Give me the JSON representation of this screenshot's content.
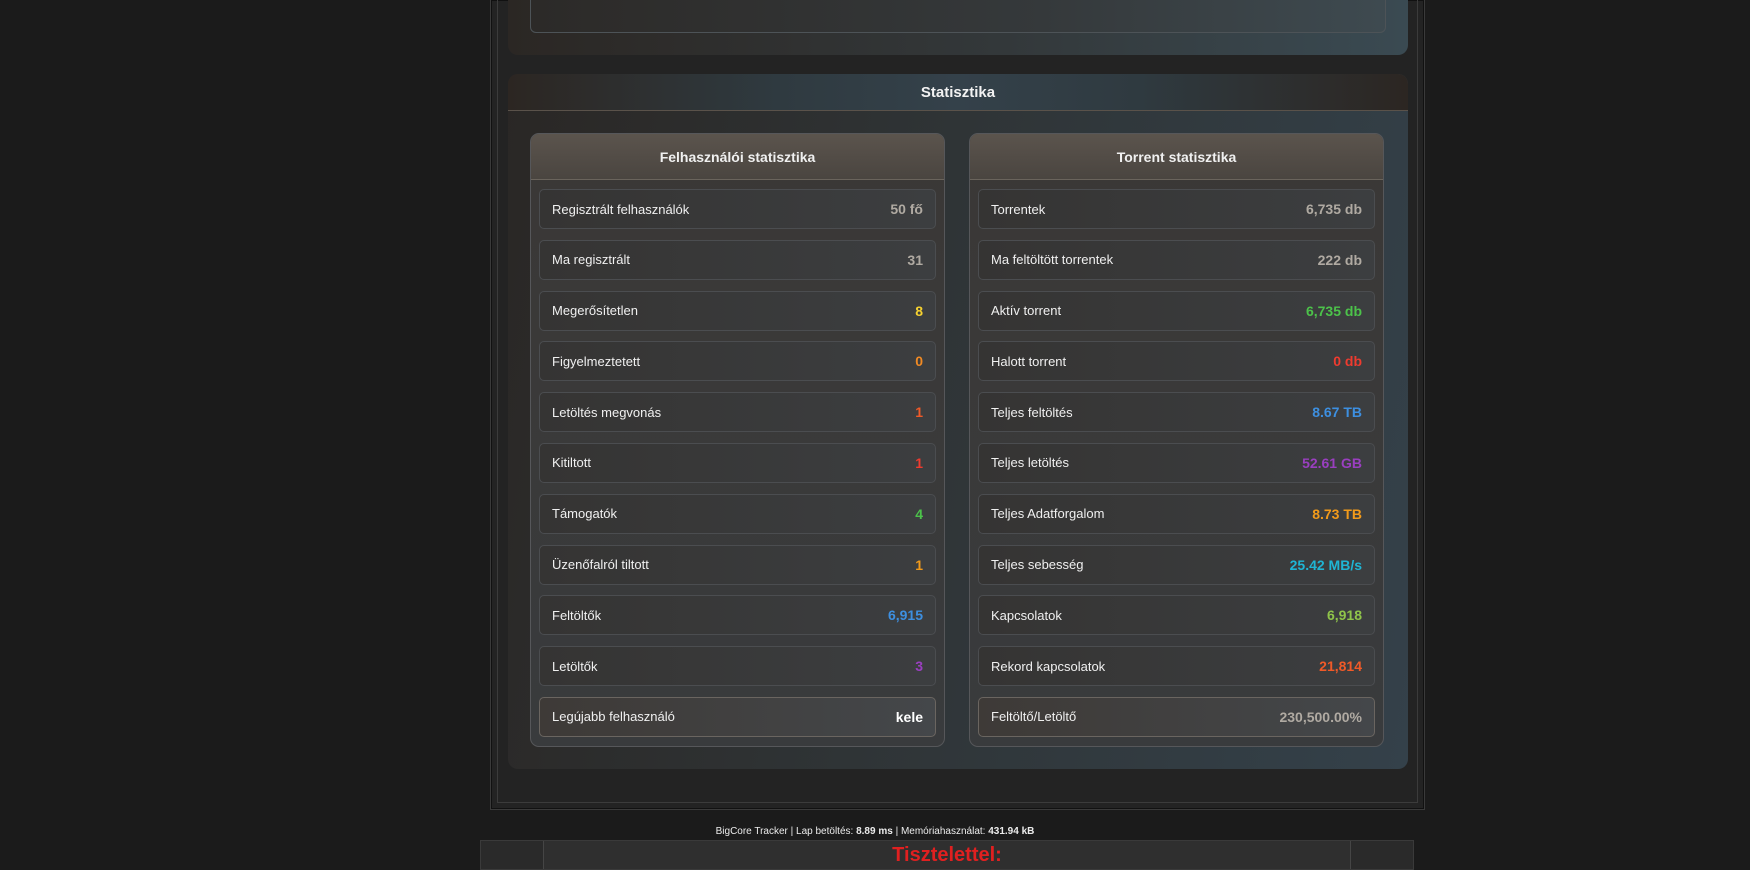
{
  "stats": {
    "title": "Statisztika",
    "user_stats": {
      "title": "Felhasználói statisztika",
      "rows": [
        {
          "label": "Regisztrált felhasználók",
          "value": "50 fő",
          "color": "#b0aaa2"
        },
        {
          "label": "Ma regisztrált",
          "value": "31",
          "color": "#b0aaa2"
        },
        {
          "label": "Megerősítetlen",
          "value": "8",
          "color": "#f5d130"
        },
        {
          "label": "Figyelmeztetett",
          "value": "0",
          "color": "#f08a24"
        },
        {
          "label": "Letöltés megvonás",
          "value": "1",
          "color": "#f05a28"
        },
        {
          "label": "Kitiltott",
          "value": "1",
          "color": "#ee3b2f"
        },
        {
          "label": "Támogatók",
          "value": "4",
          "color": "#4cc24a"
        },
        {
          "label": "Üzenőfalról tiltott",
          "value": "1",
          "color": "#f29a1a"
        },
        {
          "label": "Feltöltők",
          "value": "6,915",
          "color": "#3d8fe0"
        },
        {
          "label": "Letöltők",
          "value": "3",
          "color": "#9a3fc0"
        },
        {
          "label": "Legújabb felhasználó",
          "value": "kele",
          "color": "#ffffff",
          "highlight": true
        }
      ]
    },
    "torrent_stats": {
      "title": "Torrent statisztika",
      "rows": [
        {
          "label": "Torrentek",
          "value": "6,735 db",
          "color": "#b0aaa2"
        },
        {
          "label": "Ma feltöltött torrentek",
          "value": "222 db",
          "color": "#b0aaa2"
        },
        {
          "label": "Aktív torrent",
          "value": "6,735 db",
          "color": "#4cc24a"
        },
        {
          "label": "Halott torrent",
          "value": "0 db",
          "color": "#ee3b2f"
        },
        {
          "label": "Teljes feltöltés",
          "value": "8.67 TB",
          "color": "#3d8fe0"
        },
        {
          "label": "Teljes letöltés",
          "value": "52.61 GB",
          "color": "#9a3fc0"
        },
        {
          "label": "Teljes Adatforgalom",
          "value": "8.73 TB",
          "color": "#f29a1a"
        },
        {
          "label": "Teljes sebesség",
          "value": "25.42 MB/s",
          "color": "#1fb5d4"
        },
        {
          "label": "Kapcsolatok",
          "value": "6,918",
          "color": "#8fc44a"
        },
        {
          "label": "Rekord kapcsolatok",
          "value": "21,814",
          "color": "#f05a28"
        },
        {
          "label": "Feltöltő/Letöltő",
          "value": "230,500.00%",
          "color": "#b0aaa2",
          "highlight": true
        }
      ]
    }
  },
  "footer": {
    "site": "BigCore Tracker",
    "load_label": "Lap betöltés:",
    "load_value": "8.89 ms",
    "memory_label": "Memóriahasználat:",
    "memory_value": "431.94 kB",
    "separator": "|"
  },
  "bottom_banner": {
    "text": "Tisztelettel:"
  }
}
